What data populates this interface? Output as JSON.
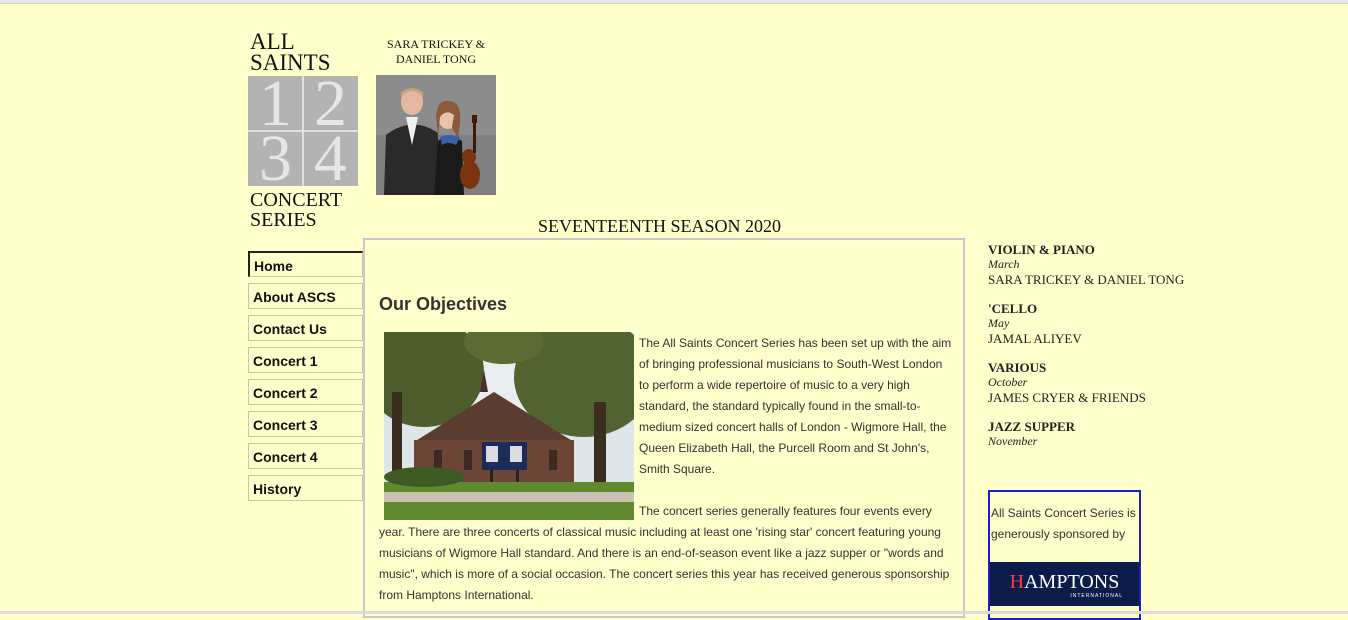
{
  "logo": {
    "line1": "ALL",
    "line2": "SAINTS",
    "digits": [
      "1",
      "2",
      "3",
      "4"
    ],
    "line3": "CONCERT",
    "line4": "SERIES"
  },
  "header": {
    "artist_caption_line1": "SARA TRICKEY &",
    "artist_caption_line2": "DANIEL TONG",
    "season_title": "SEVENTEENTH SEASON 2020"
  },
  "nav": {
    "items": [
      {
        "label": "Home"
      },
      {
        "label": "About ASCS"
      },
      {
        "label": "Contact Us"
      },
      {
        "label": "Concert 1"
      },
      {
        "label": "Concert 2"
      },
      {
        "label": "Concert 3"
      },
      {
        "label": "Concert 4"
      },
      {
        "label": "History"
      }
    ]
  },
  "main": {
    "heading": "Our Objectives",
    "paragraph1": "The All Saints Concert Series has been set up with the aim of bringing professional musicians to South-West London to perform a wide repertoire of music to a very high standard, the standard typically found in the small-to-medium sized concert halls of London - Wigmore Hall, the Queen Elizabeth Hall, the Purcell Room and St John's, Smith Square.",
    "paragraph2": "The concert series generally features four events every year.  There are three concerts of classical music including at least one 'rising star' concert featuring young musicians of Wigmore Hall standard.  And there is an end-of-season event like a jazz supper or \"words and music\", which is more of a social occasion. The concert series this year has received generous sponsorship from Hamptons International."
  },
  "events": [
    {
      "type": "VIOLIN & PIANO",
      "month": "March",
      "artist": "SARA TRICKEY & DANIEL TONG"
    },
    {
      "type": "'CELLO",
      "month": "May",
      "artist": "JAMAL ALIYEV"
    },
    {
      "type": "VARIOUS",
      "month": "October",
      "artist": "JAMES CRYER & FRIENDS"
    },
    {
      "type": "JAZZ SUPPER",
      "month": "November",
      "artist": ""
    }
  ],
  "sponsor": {
    "text": "All Saints Concert Series is generously sponsored by",
    "logo_text": "AMPTONS",
    "logo_initial": "H",
    "logo_sub": "INTERNATIONAL"
  },
  "colors": {
    "page_background": "#ffffcc",
    "sponsor_border": "#1c1cc8",
    "sponsor_logo_bg": "#0b1b4a"
  }
}
